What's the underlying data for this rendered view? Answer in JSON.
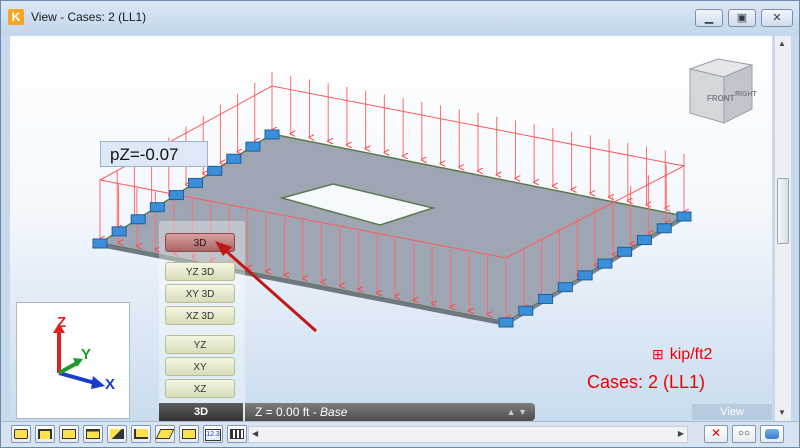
{
  "window": {
    "title": "View - Cases: 2 (LL1)",
    "app_icon": "robot-app-icon",
    "controls": {
      "minimize": "minimize-icon",
      "maximize": "maximize-icon",
      "close": "close-icon"
    }
  },
  "viewport": {
    "load_label": "pZ=-0.07",
    "view_cube": {
      "front": "FRONT",
      "right": "RIGHT"
    },
    "axes": {
      "z": "Z",
      "y": "Y",
      "x": "X"
    },
    "units": "kip/ft2",
    "cases": "Cases: 2 (LL1)",
    "colors": {
      "load": "#ff3333",
      "slab": "#9aa3b0",
      "support": "#3b8fd9",
      "label": "#e00000"
    }
  },
  "view_menu": {
    "items": [
      "3D",
      "YZ 3D",
      "XY 3D",
      "XZ 3D",
      "YZ",
      "XY",
      "XZ"
    ],
    "selected": "3D"
  },
  "status": {
    "mode": "3D",
    "z_level": "Z = 0.00 ft -",
    "z_level_name": "Base",
    "view_button": "View"
  },
  "toolbar": {
    "buttons": [
      "nodes-icon",
      "bars-icon",
      "panels-icon",
      "loads-icon",
      "edit-icon",
      "section-icon",
      "plane-icon",
      "display-icon",
      "numbers-icon",
      "grid-icon"
    ],
    "numbers_label": "12.3",
    "right_buttons": [
      "hide-icon",
      "glasses-icon",
      "render-icon"
    ]
  }
}
